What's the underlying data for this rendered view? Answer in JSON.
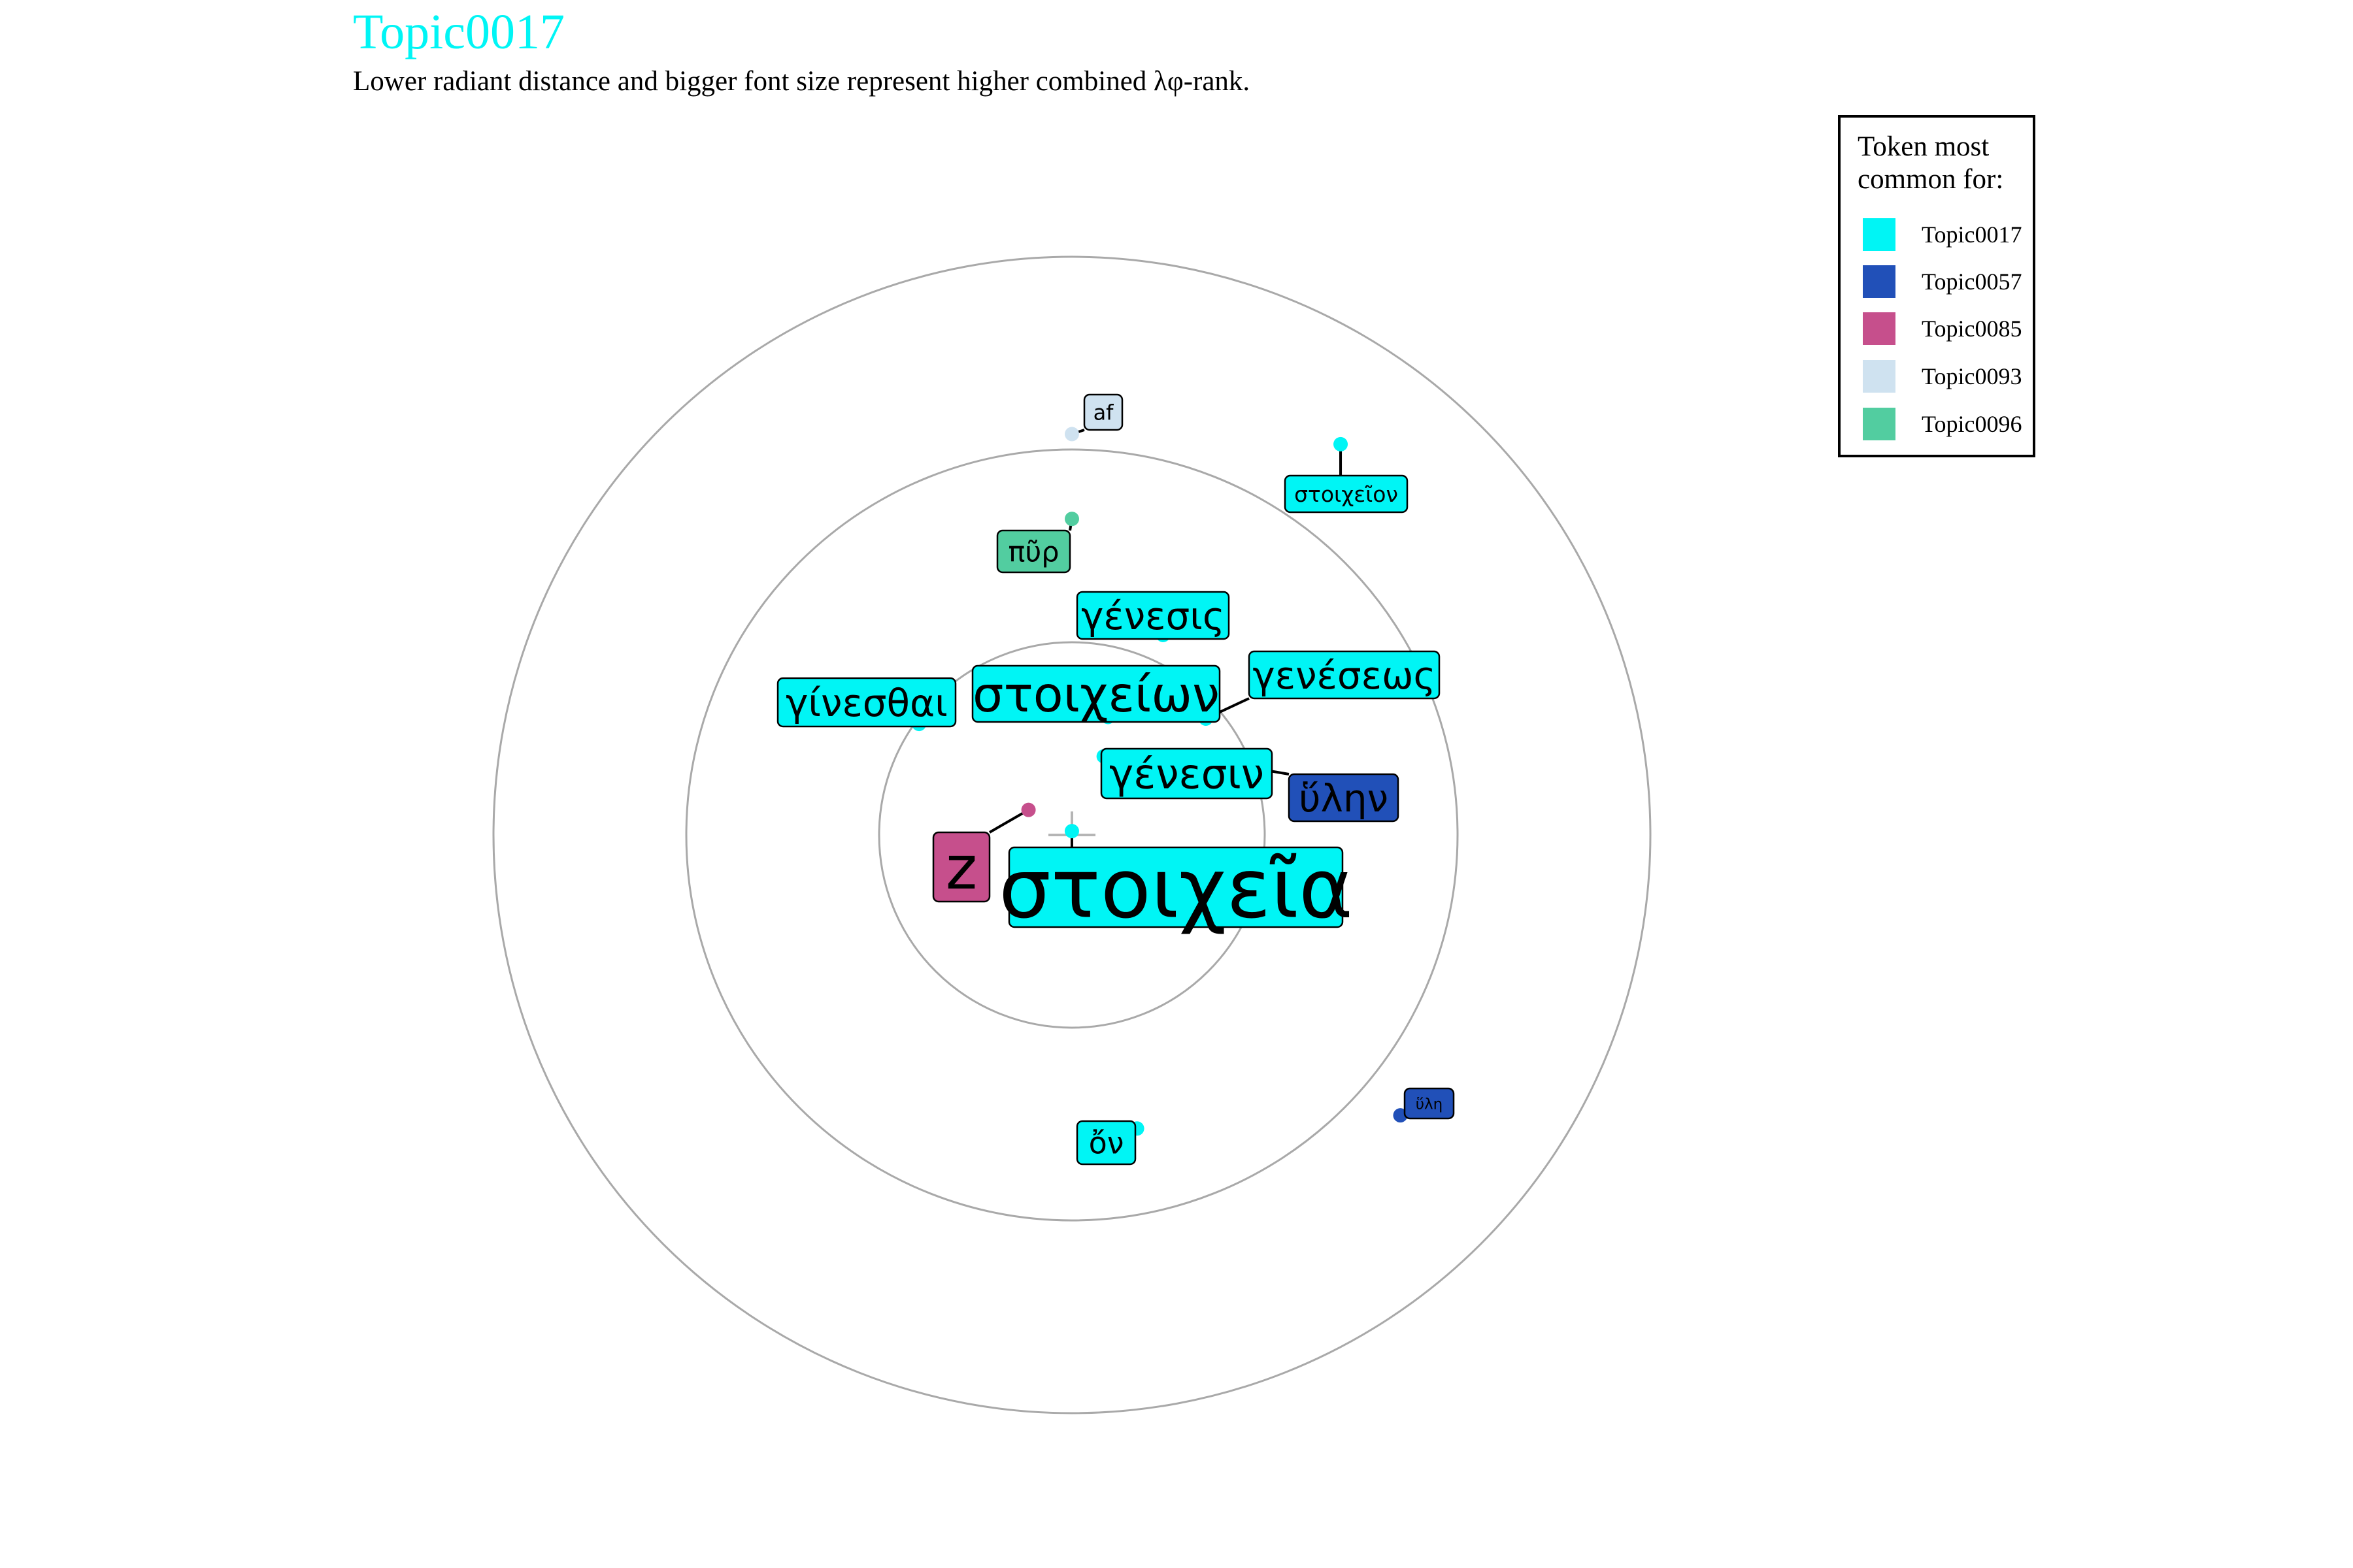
{
  "chart_data": {
    "type": "scatter",
    "coordinate_system": "polar",
    "title": "Topic0017",
    "subtitle": "Lower radiant distance and bigger font size represent higher combined λφ-rank.",
    "title_color": "#00f5f5",
    "legend": {
      "title": "Token most\ncommon for:",
      "placement": "right",
      "entries": [
        {
          "name": "Topic0017",
          "color": "#00f5f5"
        },
        {
          "name": "Topic0057",
          "color": "#2150b8"
        },
        {
          "name": "Topic0085",
          "color": "#c64f8c"
        },
        {
          "name": "Topic0093",
          "color": "#cfe2f0"
        },
        {
          "name": "Topic0096",
          "color": "#52cda0"
        }
      ]
    },
    "rings": 3,
    "grid": true,
    "points": [
      {
        "token": "στοιχεῖα",
        "topic": "Topic0017",
        "rank": 1,
        "angle_deg": -0.5,
        "radius": 0.01
      },
      {
        "token": "z",
        "topic": "Topic0085",
        "rank": 2,
        "angle_deg": -60,
        "radius": 0.13
      },
      {
        "token": "γένεσιν",
        "topic": "Topic0017",
        "rank": 3,
        "angle_deg": 22,
        "radius": 0.22
      },
      {
        "token": "στοιχείων",
        "topic": "Topic0017",
        "rank": 4,
        "angle_deg": 17,
        "radius": 0.32
      },
      {
        "token": "γένεσις",
        "topic": "Topic0017",
        "rank": 5,
        "angle_deg": 24.5,
        "radius": 0.57
      },
      {
        "token": "γενέσεως",
        "topic": "Topic0017",
        "rank": 6,
        "angle_deg": 49,
        "radius": 0.46
      },
      {
        "token": "ὕλην",
        "topic": "Topic0057",
        "rank": 7,
        "angle_deg": 69,
        "radius": 0.49
      },
      {
        "token": "γίνεσθαι",
        "topic": "Topic0017",
        "rank": 8,
        "angle_deg": -54,
        "radius": 0.49
      },
      {
        "token": "πῦρ",
        "topic": "Topic0096",
        "rank": 9,
        "angle_deg": 0,
        "radius": 0.82
      },
      {
        "token": "στοιχεῖον",
        "topic": "Topic0017",
        "rank": 10,
        "angle_deg": 34.5,
        "radius": 1.23
      },
      {
        "token": "af",
        "topic": "Topic0093",
        "rank": 11,
        "angle_deg": 0,
        "radius": 1.04
      },
      {
        "token": "ὄν",
        "topic": "Topic0017",
        "rank": 12,
        "angle_deg": 167.5,
        "radius": 0.78
      },
      {
        "token": "ὕλη",
        "topic": "Topic0057",
        "rank": 13,
        "angle_deg": 130.5,
        "radius": 1.12
      }
    ]
  }
}
